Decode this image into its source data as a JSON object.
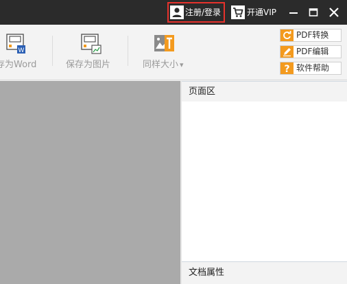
{
  "titlebar": {
    "login_label": "注册/登录",
    "vip_label": "开通VIP",
    "icons": {
      "user": "user-icon",
      "cart": "cart-icon",
      "minimize": "minimize-icon",
      "maximize": "maximize-icon",
      "close": "close-icon"
    },
    "highlight_color": "#e8322c"
  },
  "toolbar": {
    "save_word_label": "存为Word",
    "save_image_label": "保存为图片",
    "same_size_label": "同样大小",
    "dropdown_glyph": "▾",
    "side_buttons": [
      {
        "label": "PDF转换",
        "icon": "refresh-icon"
      },
      {
        "label": "PDF编辑",
        "icon": "pencil-icon"
      },
      {
        "label": "软件帮助",
        "icon": "question-icon"
      }
    ],
    "accent_color": "#f39a1e"
  },
  "panels": {
    "page_area_title": "页面区",
    "doc_props_title": "文档属性"
  }
}
